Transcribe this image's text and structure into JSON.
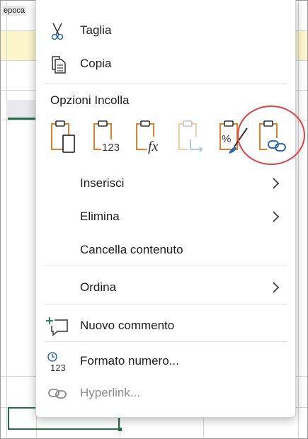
{
  "sheet": {
    "top_cell_text": "epoca"
  },
  "menu": {
    "cut_label": "Taglia",
    "copy_label": "Copia",
    "paste_options_title": "Opzioni Incolla",
    "paste_options": [
      {
        "icon": "paste-icon"
      },
      {
        "icon": "paste-values-icon",
        "text": "123"
      },
      {
        "icon": "paste-formulas-icon",
        "text": "fx"
      },
      {
        "icon": "paste-transpose-icon",
        "disabled": true
      },
      {
        "icon": "paste-formatting-icon",
        "text": "%"
      },
      {
        "icon": "paste-link-icon",
        "highlighted": true
      }
    ],
    "insert_label": "Inserisci",
    "delete_label": "Elimina",
    "clear_label": "Cancella contenuto",
    "sort_label": "Ordina",
    "new_comment_label": "Nuovo commento",
    "number_format_label": "Formato numero...",
    "number_format_icon_text": "123",
    "hyperlink_label": "Hyperlink..."
  },
  "colors": {
    "paste_orange": "#d9822b",
    "link_blue": "#2b6cb0",
    "highlight_red": "#e34242",
    "sheet_green": "#1e7145",
    "comment_green": "#2e8b57"
  }
}
